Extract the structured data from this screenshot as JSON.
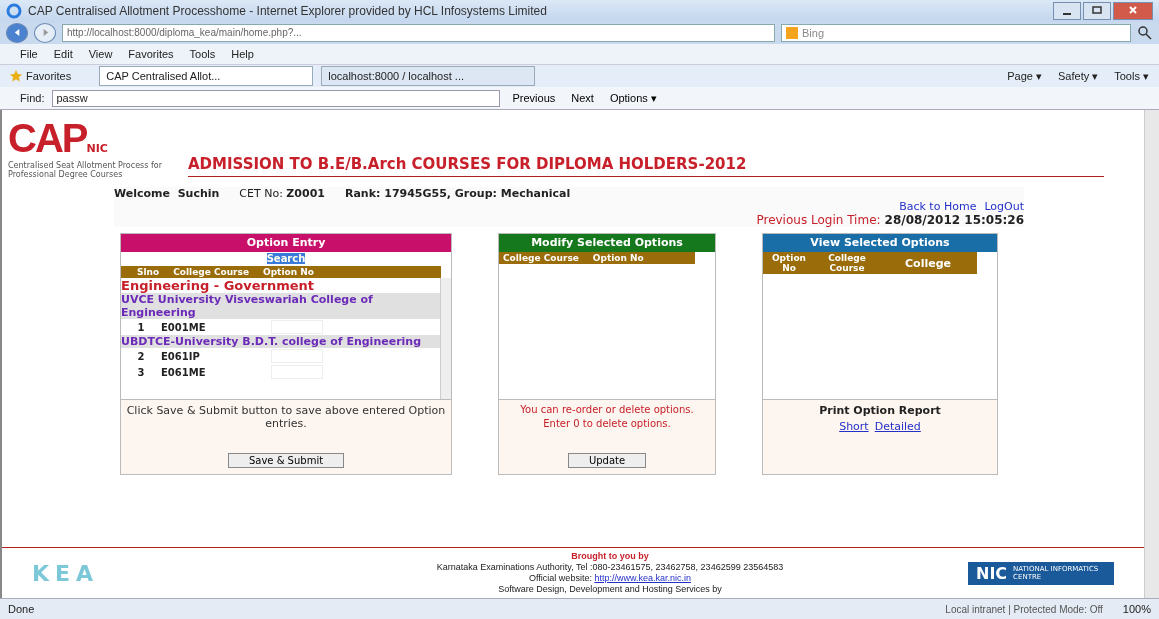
{
  "window": {
    "title": "CAP  Centralised Allotment Processhome - Internet Explorer provided by HCL Infosystems Limited"
  },
  "address_bar": {
    "url": "http://localhost:8000/diploma_kea/main/home.php?..."
  },
  "search_box": {
    "placeholder": "Bing"
  },
  "menu": [
    "File",
    "Edit",
    "View",
    "Favorites",
    "Tools",
    "Help"
  ],
  "favorites": {
    "label": "Favorites"
  },
  "tabs": [
    {
      "label": "CAP  Centralised Allot...",
      "selected": true
    },
    {
      "label": "localhost:8000 / localhost ...",
      "selected": false
    }
  ],
  "commands": [
    "Page ▾",
    "Safety ▾",
    "Tools ▾"
  ],
  "find_bar": {
    "label": "Find:",
    "value": "passw",
    "buttons": [
      "Previous",
      "Next"
    ],
    "options": "Options ▾"
  },
  "page": {
    "logo": {
      "text": "CAP",
      "sub": "NIC",
      "tagline": "Centralised Seat Allotment Process for Professional Degree Courses"
    },
    "heading": "ADMISSION TO B.E/B.Arch COURSES FOR DIPLOMA HOLDERS-2012",
    "welcome": {
      "label": "Welcome",
      "name": "Suchin",
      "cet_label": "CET No:",
      "cet": "Z0001",
      "rank": "Rank: 17945G55, Group: Mechanical"
    },
    "links": [
      "Back to Home",
      "LogOut"
    ],
    "login": {
      "label": "Previous Login Time:",
      "value": "28/08/2012 15:05:26"
    },
    "option_entry": {
      "title": "Option Entry",
      "search": "Search",
      "columns": [
        "Slno",
        "College Course",
        "Option No"
      ],
      "rows": [
        {
          "kind": "category",
          "text": "Engineering - Government"
        },
        {
          "kind": "college",
          "text": "UVCE University Visveswariah College of Engineering"
        },
        {
          "kind": "course",
          "slno": "1",
          "code": "E001ME"
        },
        {
          "kind": "college",
          "text": "UBDTCE-University B.D.T. college of Engineering"
        },
        {
          "kind": "course",
          "slno": "2",
          "code": "E061IP"
        },
        {
          "kind": "course",
          "slno": "3",
          "code": "E061ME"
        }
      ],
      "note": "Click Save & Submit button to save above entered Option entries.",
      "button": "Save & Submit"
    },
    "modify": {
      "title": "Modify Selected Options",
      "columns": [
        "College Course",
        "Option No"
      ],
      "note": [
        "You can re-order or delete options.",
        "Enter 0 to delete options."
      ],
      "button": "Update"
    },
    "view": {
      "title": "View Selected Options",
      "columns": [
        "Option No",
        "College Course",
        "College"
      ],
      "report": "Print Option Report",
      "links": [
        "Short",
        "Detailed"
      ]
    },
    "footer": {
      "brought": "Brought to you by",
      "lines": [
        "Karnataka Examinations Authority, Tel :080-23461575, 23462758, 23462599 23564583",
        "Software Design, Development and Hosting Services by"
      ],
      "website_label": "Official website:",
      "website": "http://www.kea.kar.nic.in",
      "kea": "KEA",
      "nic": "NIC",
      "nic_name": "NATIONAL INFORMATICS CENTRE"
    }
  },
  "status_bar": {
    "text": "Done",
    "zone": "Local intranet | Protected Mode: Off",
    "zoom": "100%"
  }
}
